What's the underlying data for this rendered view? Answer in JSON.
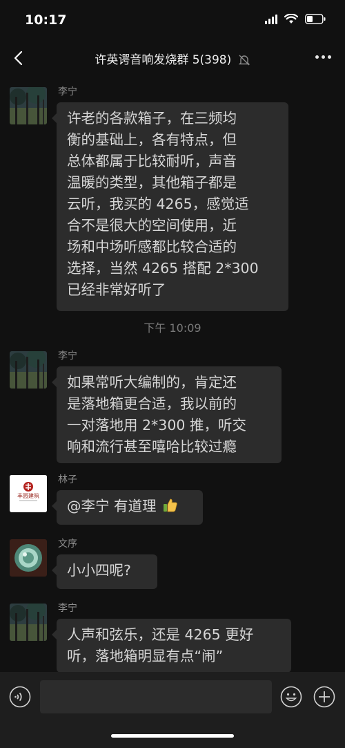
{
  "status_bar": {
    "time": "10:17"
  },
  "header": {
    "title": "许英谔音响发烧群 5(398)"
  },
  "messages": [
    {
      "sender": "李宁",
      "lines": [
        "许老的各款箱子，在三频均",
        "衡的基础上，各有特点，但",
        "总体都属于比较耐听，声音",
        "温暖的类型，其他箱子都是",
        "云听，我买的 4265，感觉适",
        "合不是很大的空间使用，近",
        "场和中场听感都比较合适的",
        "选择，当然 4265 搭配 2*300",
        "已经非常好听了"
      ]
    },
    {
      "sender": "李宁",
      "lines": [
        "如果常听大编制的，肯定还",
        "是落地箱更合适，我以前的",
        "一对落地用 2*300 推，听交",
        "响和流行甚至嘻哈比较过瘾"
      ]
    },
    {
      "sender": "林子",
      "lines": [
        "@李宁 有道理"
      ],
      "avatar_text": "丰园建筑"
    },
    {
      "sender": "文序",
      "lines": [
        "小小四呢?"
      ]
    },
    {
      "sender": "李宁",
      "lines": [
        "人声和弦乐，还是 4265 更好",
        "听，落地箱明显有点“闹”"
      ]
    }
  ],
  "timestamp": "下午 10:09",
  "icons": {
    "back": "back-arrow-icon",
    "mute": "bell-muted-icon",
    "more": "more-dots-icon",
    "voice": "voice-input-icon",
    "emoji": "emoji-icon",
    "plus": "plus-icon",
    "thumbs_up": "thumbs-up-icon"
  },
  "colors": {
    "background": "#111111",
    "bubble": "#2c2c2c",
    "text": "#d6d6d6",
    "muted_text": "#8f8f8f"
  }
}
